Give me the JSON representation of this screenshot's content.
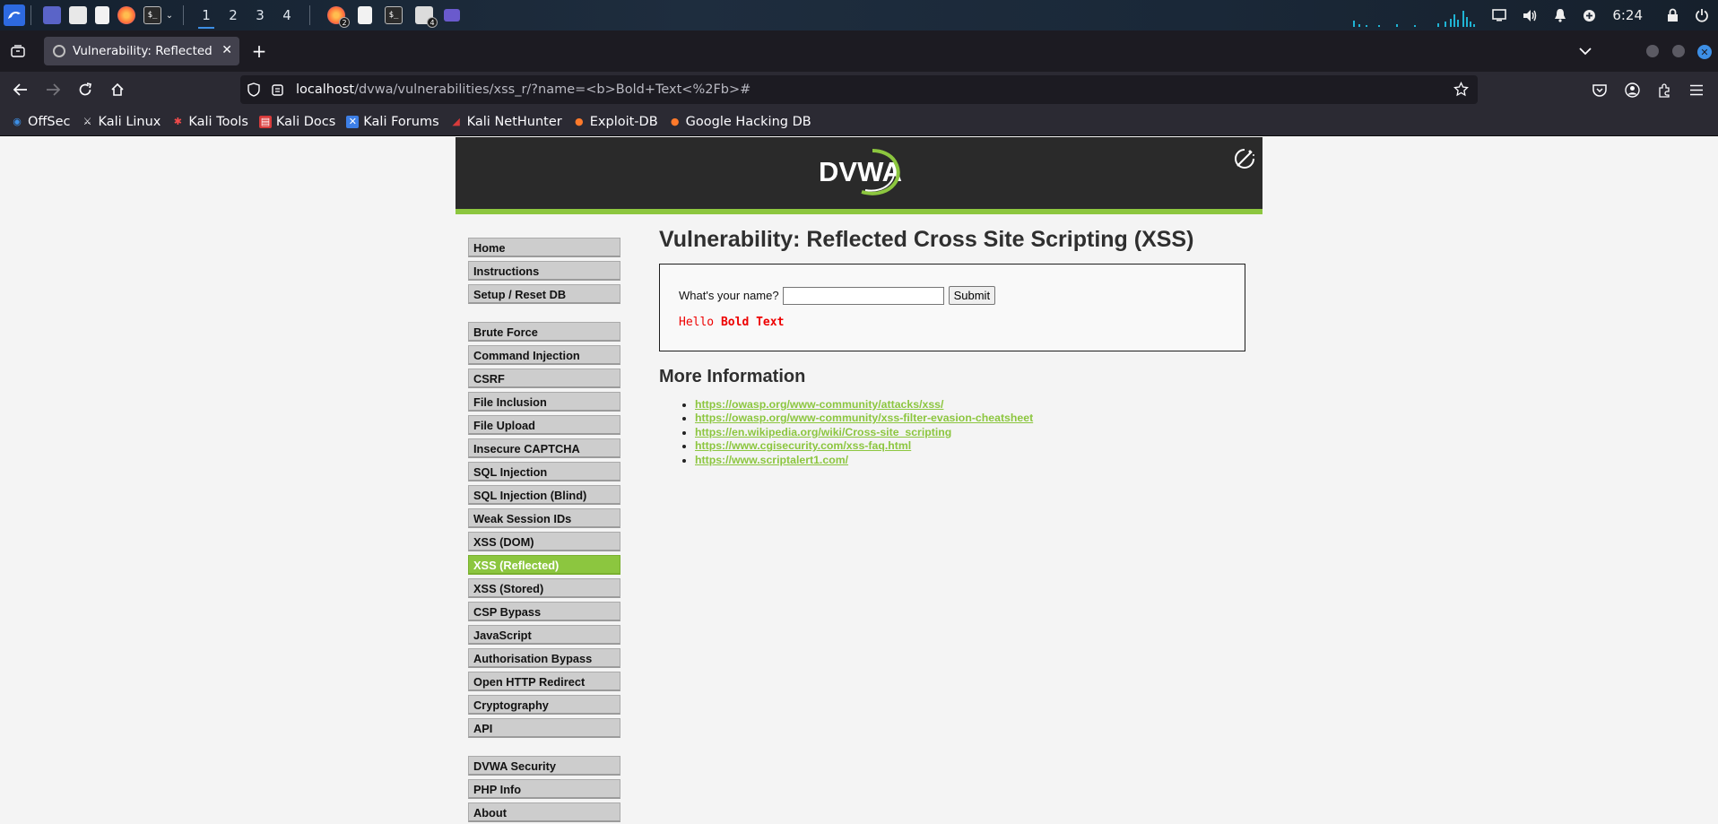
{
  "taskbar": {
    "workspaces": [
      "1",
      "2",
      "3",
      "4"
    ],
    "firefox_badge": "2",
    "files_badge": "4",
    "clock": "6:24"
  },
  "browser": {
    "tab_title": "Vulnerability: Reflected Cross Site Scripting (XSS)",
    "url_host": "localhost",
    "url_path": "/dvwa/vulnerabilities/xss_r/?name=<b>Bold+Text<%2Fb>#",
    "bookmarks": [
      "OffSec",
      "Kali Linux",
      "Kali Tools",
      "Kali Docs",
      "Kali Forums",
      "Kali NetHunter",
      "Exploit-DB",
      "Google Hacking DB"
    ]
  },
  "dvwa": {
    "logo_text": "DVWA",
    "menu_group1": [
      "Home",
      "Instructions",
      "Setup / Reset DB"
    ],
    "menu_group2": [
      "Brute Force",
      "Command Injection",
      "CSRF",
      "File Inclusion",
      "File Upload",
      "Insecure CAPTCHA",
      "SQL Injection",
      "SQL Injection (Blind)",
      "Weak Session IDs",
      "XSS (DOM)",
      "XSS (Reflected)",
      "XSS (Stored)",
      "CSP Bypass",
      "JavaScript",
      "Authorisation Bypass",
      "Open HTTP Redirect",
      "Cryptography",
      "API"
    ],
    "menu_group3": [
      "DVWA Security",
      "PHP Info",
      "About"
    ],
    "selected_item": "XSS (Reflected)",
    "page_title": "Vulnerability: Reflected Cross Site Scripting (XSS)",
    "form": {
      "label": "What's your name?",
      "input_value": "",
      "submit_label": "Submit"
    },
    "output": {
      "prefix": "Hello ",
      "bold": "Bold Text"
    },
    "more_info_title": "More Information",
    "links": [
      "https://owasp.org/www-community/attacks/xss/",
      "https://owasp.org/www-community/xss-filter-evasion-cheatsheet",
      "https://en.wikipedia.org/wiki/Cross-site_scripting",
      "https://www.cgisecurity.com/xss-faq.html",
      "https://www.scriptalert1.com/"
    ]
  },
  "colors": {
    "accent_green": "#8cc63f",
    "header_dark": "#2a2a2a",
    "output_red": "#ee0000"
  }
}
